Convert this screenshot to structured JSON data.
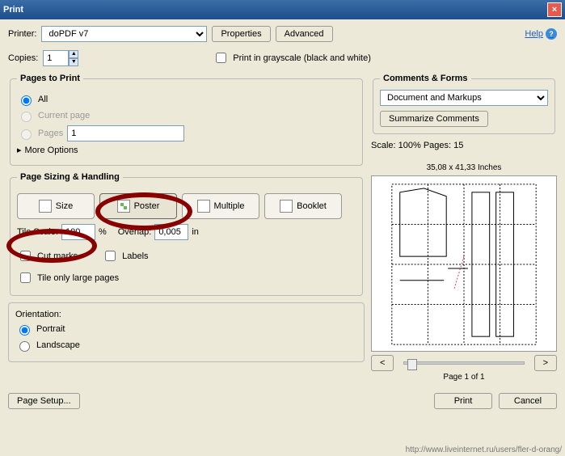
{
  "title": "Print",
  "help": "Help",
  "printer_label": "Printer:",
  "printer_value": "doPDF v7",
  "properties": "Properties",
  "advanced": "Advanced",
  "copies_label": "Copies:",
  "copies_value": "1",
  "grayscale": "Print in grayscale (black and white)",
  "pages_to_print": "Pages to Print",
  "all": "All",
  "current_page": "Current page",
  "pages": "Pages",
  "pages_val": "1",
  "more_options": "More Options",
  "sizing_heading": "Page Sizing & Handling",
  "mode_size": "Size",
  "mode_poster": "Poster",
  "mode_multiple": "Multiple",
  "mode_booklet": "Booklet",
  "tile_scale_label": "Tile Scale:",
  "tile_scale_value": "100",
  "tile_scale_unit": "%",
  "overlap_label": "Overlap:",
  "overlap_value": "0,005",
  "overlap_unit": "in",
  "cut_marks": "Cut marks",
  "labels": "Labels",
  "tile_large": "Tile only large pages",
  "orientation": "Orientation:",
  "portrait": "Portrait",
  "landscape": "Landscape",
  "comments_forms": "Comments & Forms",
  "comments_value": "Document and Markups",
  "summarize": "Summarize Comments",
  "scale_pages": "Scale: 100% Pages: 15",
  "dimensions": "35,08 x 41,33 Inches",
  "prev": "<",
  "next": ">",
  "page_of": "Page 1 of 1",
  "page_setup": "Page Setup...",
  "print": "Print",
  "cancel": "Cancel",
  "url": "http://www.liveinternet.ru/users/fler-d-orang/"
}
